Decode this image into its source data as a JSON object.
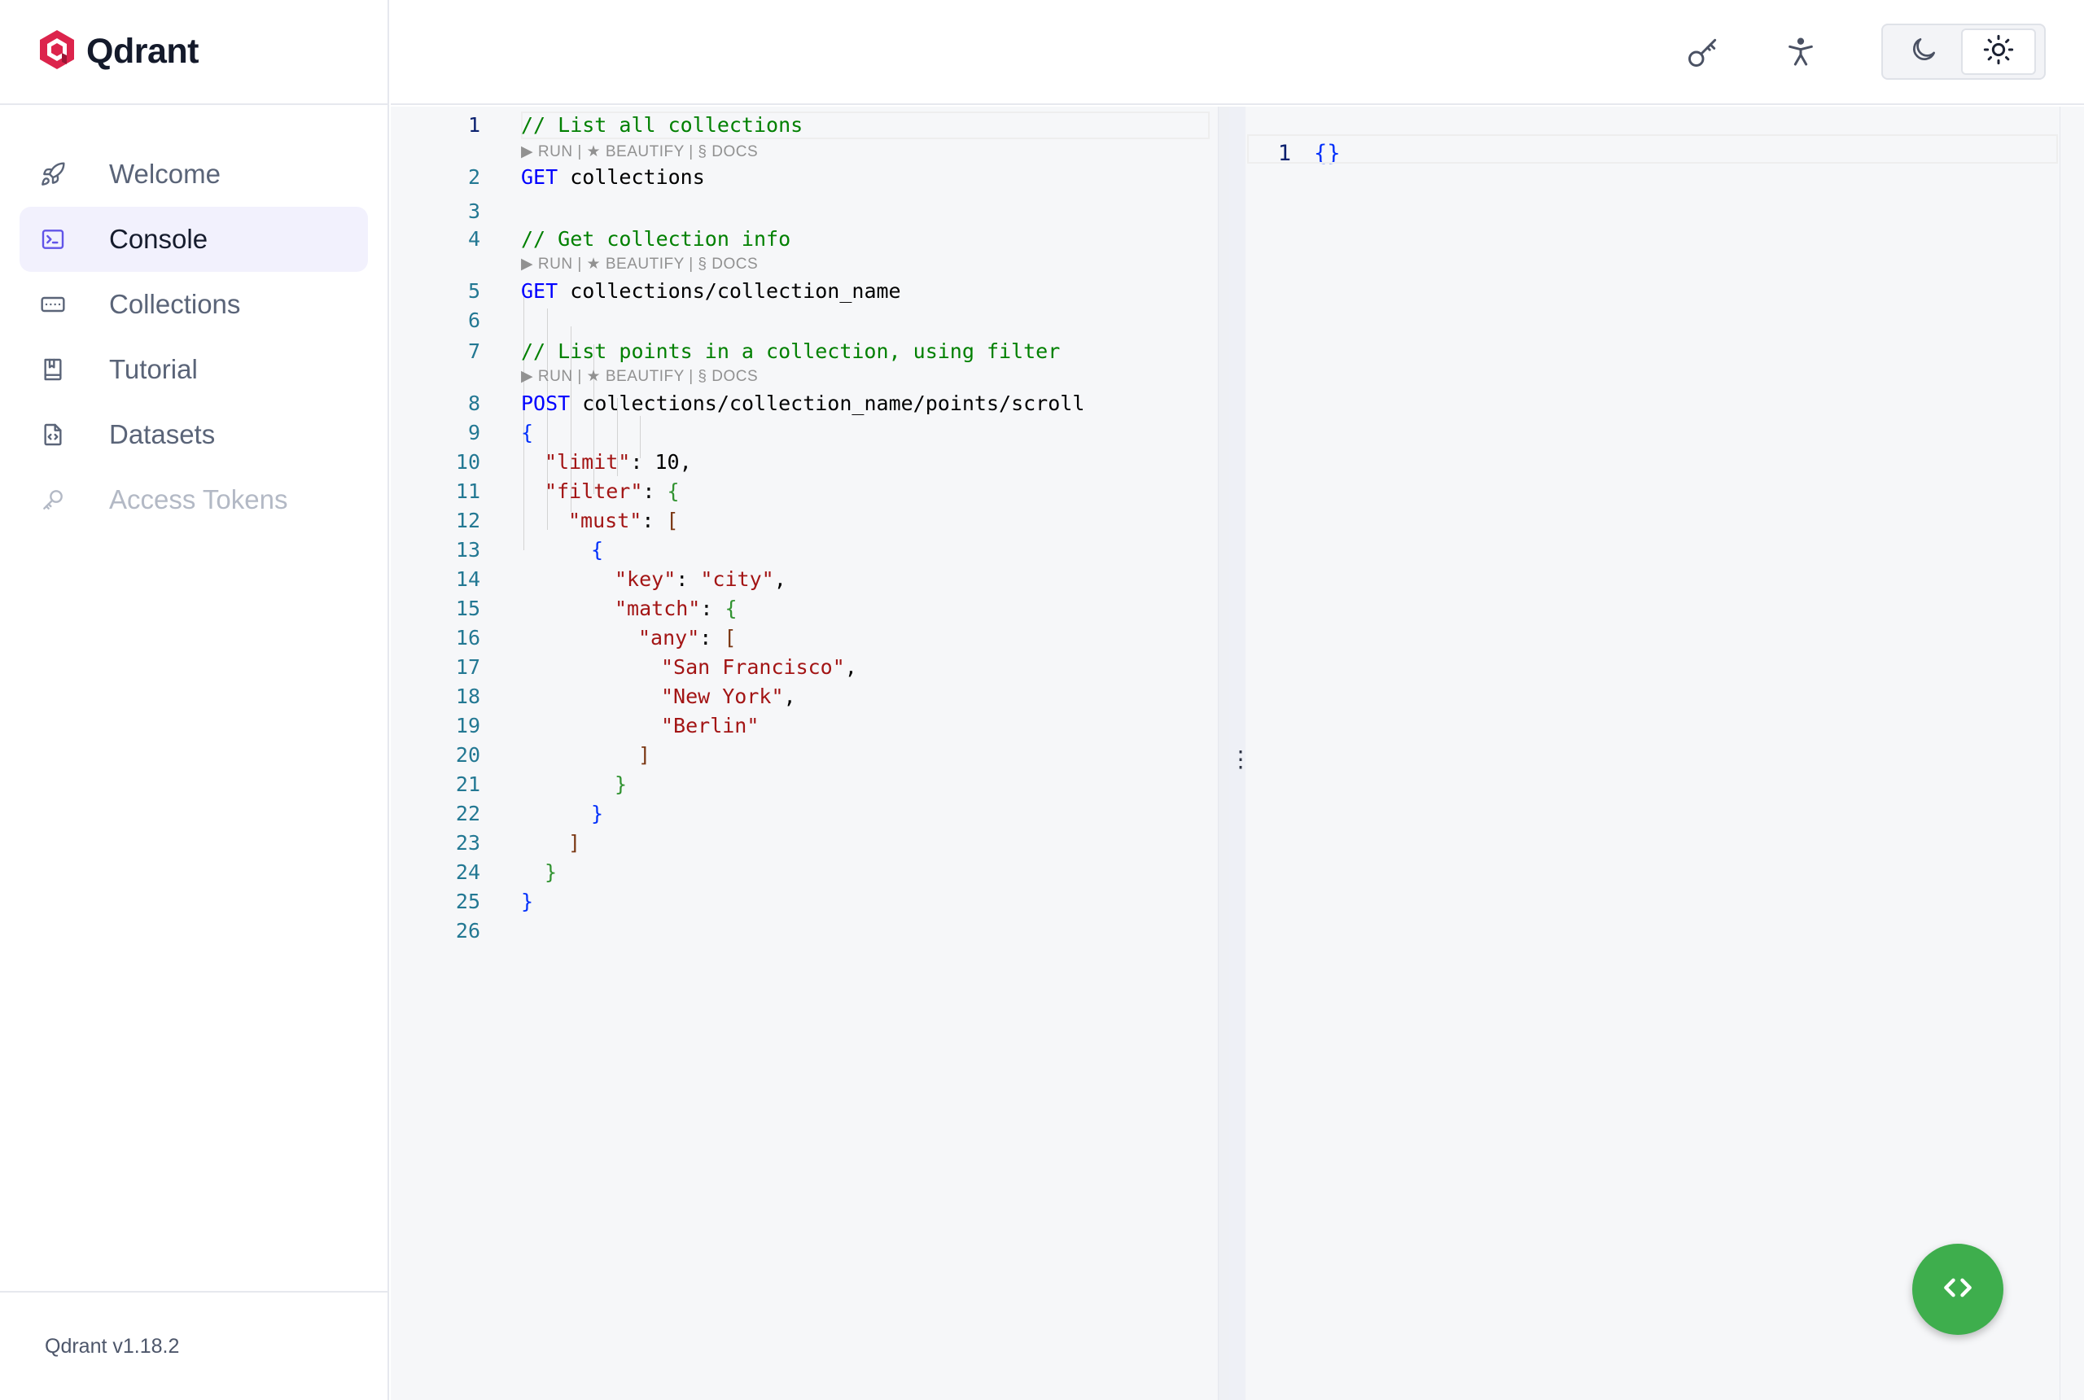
{
  "brand": {
    "name": "Qdrant",
    "accent": "#dc244c"
  },
  "sidebar": {
    "items": [
      {
        "label": "Welcome",
        "icon": "rocket-icon"
      },
      {
        "label": "Console",
        "icon": "terminal-icon"
      },
      {
        "label": "Collections",
        "icon": "collections-icon"
      },
      {
        "label": "Tutorial",
        "icon": "book-icon"
      },
      {
        "label": "Datasets",
        "icon": "file-code-icon"
      },
      {
        "label": "Access Tokens",
        "icon": "key-icon"
      }
    ],
    "active": "Console",
    "disabled": "Access Tokens",
    "version": "Qdrant v1.18.2"
  },
  "header": {
    "buttons": [
      {
        "icon": "key-icon"
      },
      {
        "icon": "accessibility-icon"
      }
    ],
    "theme": {
      "options": [
        "moon-icon",
        "sun-icon"
      ],
      "selected": "sun-icon"
    }
  },
  "editor": {
    "code_lens": "▶ RUN | ★ BEAUTIFY | § DOCS",
    "line_numbers": [
      "1",
      "2",
      "3",
      "4",
      "5",
      "6",
      "7",
      "8",
      "9",
      "10",
      "11",
      "12",
      "13",
      "14",
      "15",
      "16",
      "17",
      "18",
      "19",
      "20",
      "21",
      "22",
      "23",
      "24",
      "25",
      "26"
    ],
    "comments": {
      "c1": "// List all collections",
      "c2": "// Get collection info",
      "c3": "// List points in a collection, using filter"
    },
    "requests": [
      {
        "method": "GET",
        "path": "collections"
      },
      {
        "method": "GET",
        "path": "collections/collection_name"
      },
      {
        "method": "POST",
        "path": "collections/collection_name/points/scroll"
      }
    ],
    "body": {
      "limit_key": "\"limit\"",
      "limit_value": "10",
      "filter_key": "\"filter\"",
      "must_key": "\"must\"",
      "key_key": "\"key\"",
      "key_value": "\"city\"",
      "match_key": "\"match\"",
      "any_key": "\"any\"",
      "values": [
        "\"San Francisco\"",
        "\"New York\"",
        "\"Berlin\""
      ]
    }
  },
  "result": {
    "line_number": "1",
    "content": "{}"
  },
  "fab": {
    "icon": "code-brackets-icon",
    "color": "#3eae4d"
  }
}
